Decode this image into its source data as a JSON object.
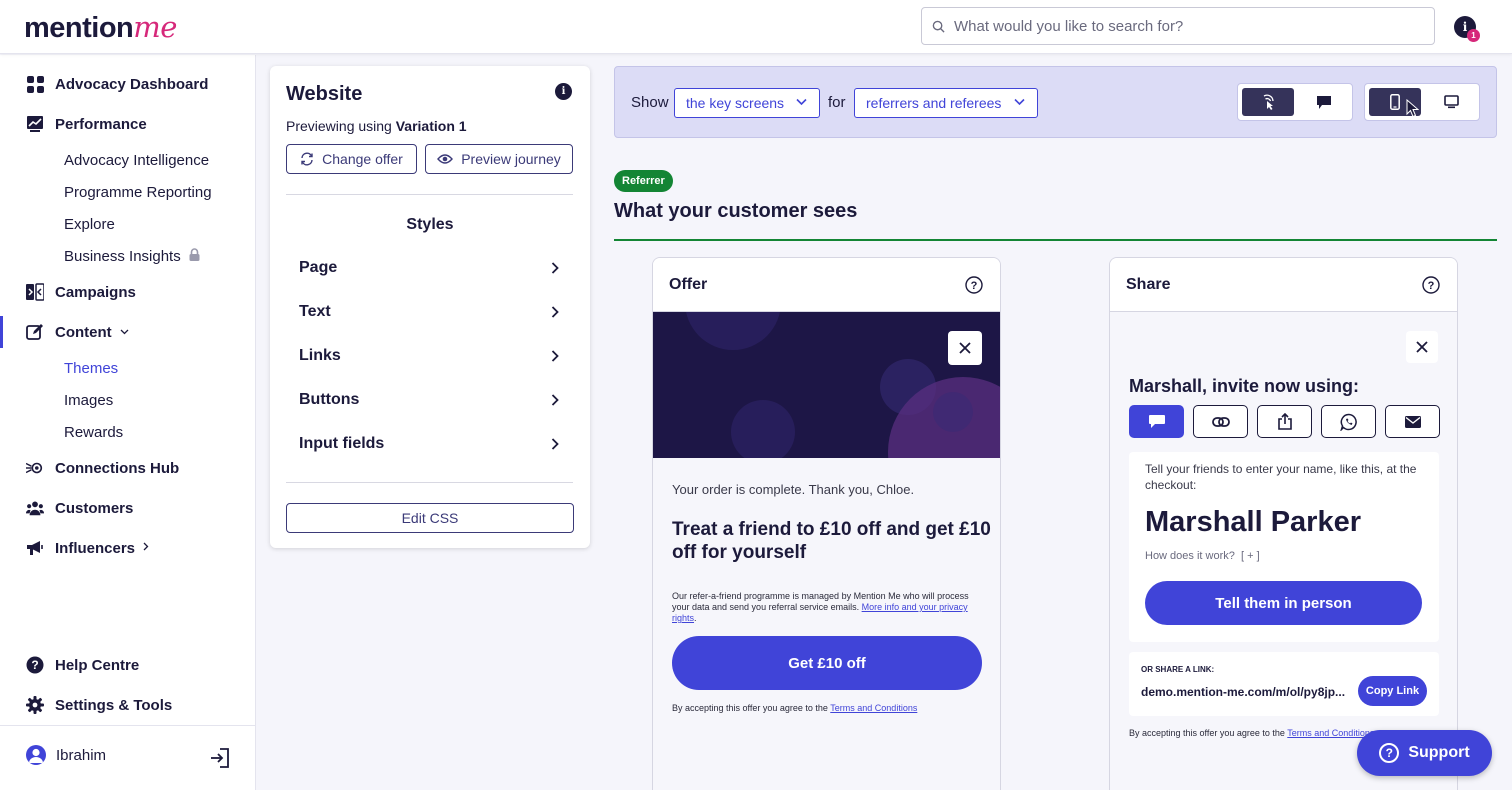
{
  "header": {
    "logo_main": "mention",
    "logo_accent": "me",
    "search_placeholder": "What would you like to search for?",
    "notification_count": "1",
    "notification_icon": "i"
  },
  "sidebar": {
    "items": [
      {
        "label": "Advocacy Dashboard",
        "icon": "dashboard-icon"
      },
      {
        "label": "Performance",
        "icon": "chart-icon"
      },
      {
        "label": "Campaigns",
        "icon": "campaigns-icon"
      },
      {
        "label": "Content",
        "icon": "edit-icon"
      },
      {
        "label": "Connections Hub",
        "icon": "connections-icon"
      },
      {
        "label": "Customers",
        "icon": "customers-icon"
      },
      {
        "label": "Influencers",
        "icon": "megaphone-icon"
      },
      {
        "label": "Help Centre",
        "icon": "help-icon"
      },
      {
        "label": "Settings & Tools",
        "icon": "gear-icon"
      }
    ],
    "performance_sub": [
      "Advocacy Intelligence",
      "Programme Reporting",
      "Explore",
      "Business Insights"
    ],
    "content_sub": [
      "Themes",
      "Images",
      "Rewards"
    ],
    "user_name": "Ibrahim"
  },
  "panel": {
    "title": "Website",
    "previewing_prefix": "Previewing using",
    "variation": "Variation 1",
    "change_offer": "Change offer",
    "preview_journey": "Preview journey",
    "styles_title": "Styles",
    "styles": [
      "Page",
      "Text",
      "Links",
      "Buttons",
      "Input fields"
    ],
    "edit_css": "Edit CSS",
    "info_icon": "i"
  },
  "filter": {
    "show_label": "Show",
    "screens_value": "the key screens",
    "for_label": "for",
    "audience_value": "referrers and referees"
  },
  "content": {
    "badge": "Referrer",
    "title": "What your customer sees"
  },
  "offer_card": {
    "title": "Offer",
    "order_text": "Your order is complete. Thank you, Chloe.",
    "headline": "Treat a friend to £10 off and get £10 off for yourself",
    "fine_print": "Our refer-a-friend programme is managed by Mention Me who will process your data and send you referral service emails.",
    "fine_link": "More info and your privacy rights",
    "fine_end": ".",
    "cta": "Get £10 off",
    "terms_prefix": "By accepting this offer you agree to the",
    "terms_link": "Terms and Conditions"
  },
  "share_card": {
    "title": "Share",
    "invite_title": "Marshall, invite now using:",
    "tell_text": "Tell your friends to enter your name, like this, at the checkout:",
    "name": "Marshall Parker",
    "how": "How does it work?",
    "how_toggle": "[ + ]",
    "cta": "Tell them in person",
    "or_share": "OR SHARE A LINK:",
    "link": "demo.mention-me.com/m/ol/py8jp...",
    "copy": "Copy Link",
    "terms_prefix": "By accepting this offer you agree to the",
    "terms_link": "Terms and Conditions"
  },
  "support": {
    "label": "Support",
    "icon": "?"
  },
  "colors": {
    "accent": "#4044d8",
    "brand_pink": "#d6287a",
    "navy": "#1c1a3b",
    "referrer_green": "#138534"
  }
}
